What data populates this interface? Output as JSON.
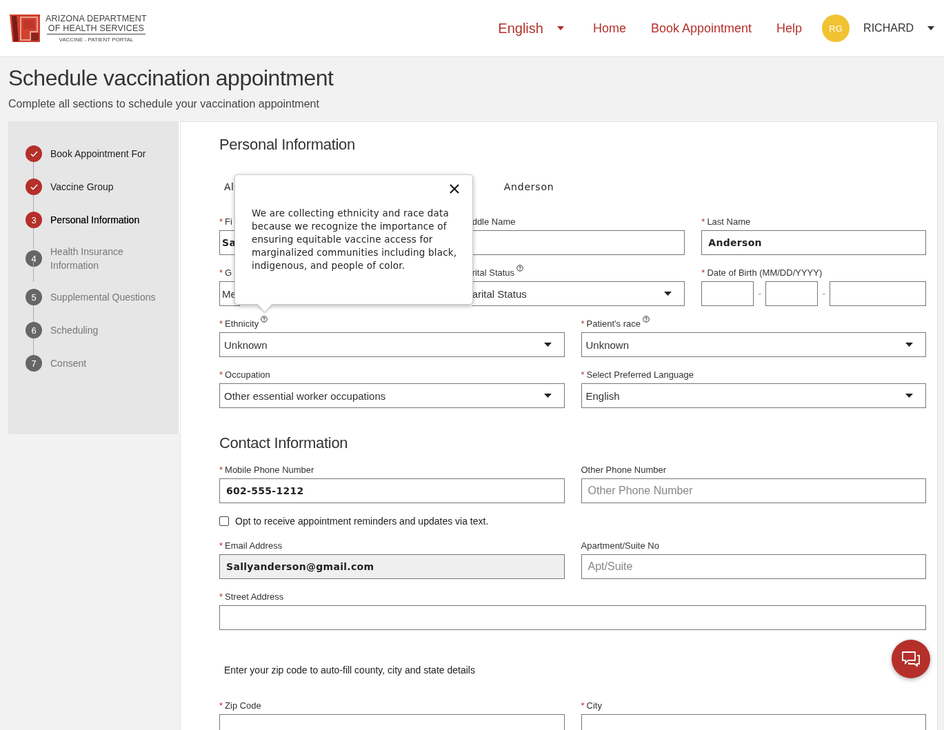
{
  "header": {
    "logo": {
      "line1": "ARIZONA DEPARTMENT",
      "line2": "OF HEALTH SERVICES",
      "line3": "VACCINE - PATIENT PORTAL"
    },
    "nav": [
      {
        "label": "English",
        "kind": "dropdown"
      },
      {
        "label": "Home",
        "kind": "link"
      },
      {
        "label": "Book Appointment",
        "kind": "link"
      },
      {
        "label": "Help",
        "kind": "link"
      }
    ],
    "user": {
      "initials": "RG",
      "name": "RICHARD"
    }
  },
  "title": "Schedule vaccination appointment",
  "subtitle": "Complete all sections to schedule your vaccination appointment",
  "steps": [
    {
      "label": "Book Appointment For",
      "done": true,
      "selected": false
    },
    {
      "label": "Vaccine Group",
      "done": true,
      "selected": false
    },
    {
      "number": "3",
      "label": "Personal Information",
      "done": false,
      "selected": true
    },
    {
      "number": "4",
      "label": "Health Insurance Information",
      "done": false,
      "selected": false
    },
    {
      "number": "5",
      "label": "Supplemental Questions",
      "done": false,
      "selected": false
    },
    {
      "number": "6",
      "label": "Scheduling",
      "done": false,
      "selected": false
    },
    {
      "number": "7",
      "label": "Consent",
      "done": false,
      "selected": false
    }
  ],
  "sections": [
    {
      "title": "Personal Information",
      "intro": [
        "Al",
        "Anderson"
      ],
      "rows": [
        {
          "kind": "fields",
          "fields": [
            {
              "kind": "text",
              "mark": "*",
              "label": "Fi",
              "value": "Sa",
              "cut_right": true
            },
            {
              "kind": "text",
              "label": "ddle Name",
              "cut_left": true
            },
            {
              "kind": "text",
              "mark": "*",
              "label": "Last Name",
              "value": "Anderson"
            }
          ]
        },
        {
          "kind": "fields",
          "fields": [
            {
              "kind": "select",
              "mark": "*",
              "label": "G",
              "value": "Me",
              "cut_right": true
            },
            {
              "kind": "select",
              "label": "rital Status",
              "help": true,
              "value": "arital Status",
              "cut_left": true
            },
            {
              "kind": "date",
              "mark": "*",
              "label": "Date of Birth (MM/DD/YYYY)",
              "separators": [
                "-",
                "-"
              ]
            }
          ]
        },
        {
          "kind": "fields",
          "fields": [
            {
              "kind": "select",
              "mark": "*",
              "label": "Ethnicity",
              "help": true,
              "value": "Unknown"
            },
            {
              "kind": "select",
              "mark": "*",
              "label": "Patient's race",
              "help": true,
              "value": "Unknown"
            }
          ]
        },
        {
          "kind": "fields",
          "fields": [
            {
              "kind": "select",
              "mark": "*",
              "label": "Occupation",
              "value": "Other essential worker occupations"
            },
            {
              "kind": "select",
              "mark": "*",
              "label": "Select Preferred Language",
              "value": "English"
            }
          ]
        }
      ]
    },
    {
      "title": "Contact Information",
      "rows": [
        {
          "kind": "fields",
          "fields": [
            {
              "kind": "text",
              "mark": "*",
              "label": "Mobile Phone Number",
              "value": "602-555-1212"
            },
            {
              "kind": "text",
              "label": "Other Phone Number",
              "placeholder": "Other Phone Number"
            }
          ]
        },
        {
          "kind": "checkbox",
          "label": "Opt to receive appointment reminders and updates via text.",
          "checked": false
        },
        {
          "kind": "fields",
          "fields": [
            {
              "kind": "text",
              "mark": "*",
              "label": "Email Address",
              "value": "Sallyanderson@gmail.com",
              "disabled": true
            },
            {
              "kind": "text",
              "label": "Apartment/Suite No",
              "placeholder": "Apt/Suite"
            }
          ]
        },
        {
          "kind": "fields",
          "fields": [
            {
              "kind": "text",
              "mark": "*",
              "label": "Street Address"
            }
          ]
        },
        {
          "kind": "note",
          "text": "Enter your zip code to auto-fill county, city and state details"
        },
        {
          "kind": "fields",
          "fields": [
            {
              "kind": "text",
              "mark": "*",
              "label": "Zip Code"
            },
            {
              "kind": "text",
              "mark": "*",
              "label": "City"
            }
          ]
        }
      ]
    }
  ],
  "popover": {
    "text": "We are collecting ethnicity and race data because we recognize the importance of ensuring equitable vaccine access for marginalized communities including black, indigenous, and people of color."
  }
}
